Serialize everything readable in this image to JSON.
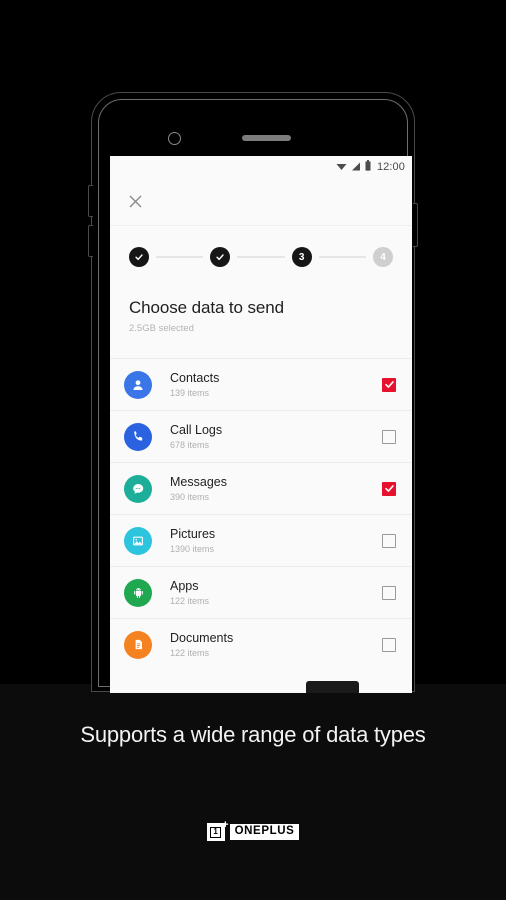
{
  "caption": {
    "text": "Supports a wide range of data types"
  },
  "brand": {
    "logo_digit": "1",
    "logo_plus": "+",
    "wordmark": "ONEPLUS"
  },
  "phone": {
    "camera_icon": "camera-dot",
    "speaker_icon": "speaker-grill"
  },
  "status_bar": {
    "wifi_icon": "wifi-icon",
    "signal_icon": "signal-icon",
    "battery_icon": "battery-icon",
    "time": "12:00"
  },
  "app_bar": {
    "close_icon": "close-icon"
  },
  "stepper": {
    "steps": [
      {
        "label": "1",
        "state": "complete",
        "glyph": "check"
      },
      {
        "label": "2",
        "state": "complete",
        "glyph": "check"
      },
      {
        "label": "3",
        "state": "current",
        "glyph": "3"
      },
      {
        "label": "4",
        "state": "upcoming",
        "glyph": "4"
      }
    ]
  },
  "header": {
    "title": "Choose data to send",
    "subtitle": "2.5GB selected"
  },
  "list": {
    "rows": [
      {
        "label": "Contacts",
        "count": "139 items",
        "icon": "contact-icon",
        "color": "#3a76e8",
        "checked": true
      },
      {
        "label": "Call Logs",
        "count": "678 items",
        "icon": "phone-icon",
        "color": "#2a62e0",
        "checked": false
      },
      {
        "label": "Messages",
        "count": "390 items",
        "icon": "message-icon",
        "color": "#1cae99",
        "checked": true
      },
      {
        "label": "Pictures",
        "count": "1390 items",
        "icon": "picture-icon",
        "color": "#2dc4dd",
        "checked": false
      },
      {
        "label": "Apps",
        "count": "122 items",
        "icon": "android-icon",
        "color": "#1fa84f",
        "checked": false
      },
      {
        "label": "Documents",
        "count": "122 items",
        "icon": "document-icon",
        "color": "#f58220",
        "checked": false
      }
    ]
  },
  "colors": {
    "accent_red": "#e8112d",
    "screen_bg": "#fafafa",
    "backdrop": "#000000"
  }
}
